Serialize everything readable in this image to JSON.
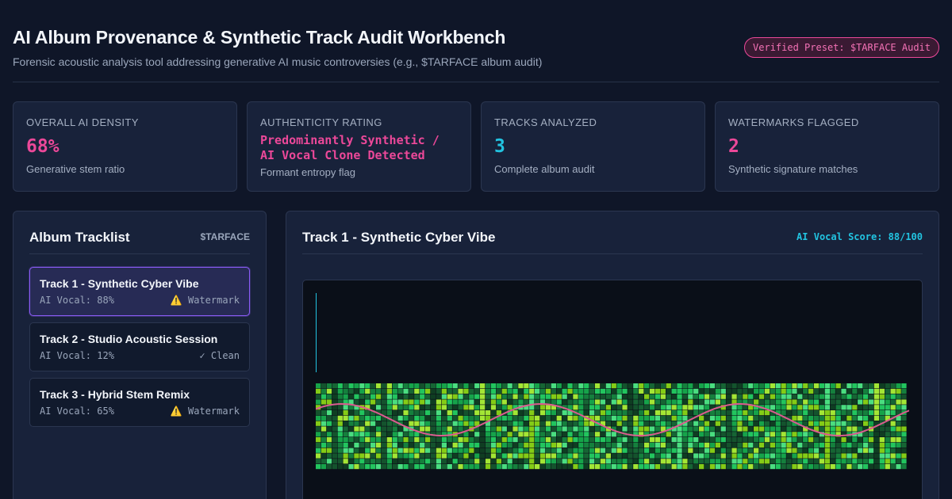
{
  "header": {
    "title": "AI Album Provenance & Synthetic Track Audit Workbench",
    "subtitle": "Forensic acoustic analysis tool addressing generative AI music controversies (e.g., $TARFACE album audit)",
    "preset_badge": "Verified Preset: $TARFACE Audit"
  },
  "stats": [
    {
      "label": "Overall AI Density",
      "value": "68%",
      "sub": "Generative stem ratio",
      "color": "#ec4899"
    },
    {
      "label": "Authenticity Rating",
      "value": "Predominantly Synthetic / AI Vocal Clone Detected",
      "sub": "Formant entropy flag",
      "color": "#ec4899"
    },
    {
      "label": "Tracks Analyzed",
      "value": "3",
      "sub": "Complete album audit",
      "color": "#22c3e0"
    },
    {
      "label": "Watermarks Flagged",
      "value": "2",
      "sub": "Synthetic signature matches",
      "color": "#ec4899"
    }
  ],
  "tracklist": {
    "title": "Album Tracklist",
    "artist_tag": "$TARFACE",
    "tracks": [
      {
        "name": "Track 1 - Synthetic Cyber Vibe",
        "ai_vocal": "AI Vocal: 88%",
        "status_icon": "warning-icon",
        "status": "Watermark",
        "active": true
      },
      {
        "name": "Track 2 - Studio Acoustic Session",
        "ai_vocal": "AI Vocal: 12%",
        "status_icon": "check-icon",
        "status": "Clean",
        "active": false
      },
      {
        "name": "Track 3 - Hybrid Stem Remix",
        "ai_vocal": "AI Vocal: 65%",
        "status_icon": "warning-icon",
        "status": "Watermark",
        "active": false
      }
    ]
  },
  "detail": {
    "title": "Track 1 - Synthetic Cyber Vibe",
    "score": "AI Vocal Score: 88/100"
  },
  "colors": {
    "accent_pink": "#ec4899",
    "accent_cyan": "#22c3e0",
    "accent_violet": "#8b5cf6",
    "spectro_low": "#14532d",
    "spectro_high": "#a3e635",
    "formant_line": "#db5b8f"
  }
}
